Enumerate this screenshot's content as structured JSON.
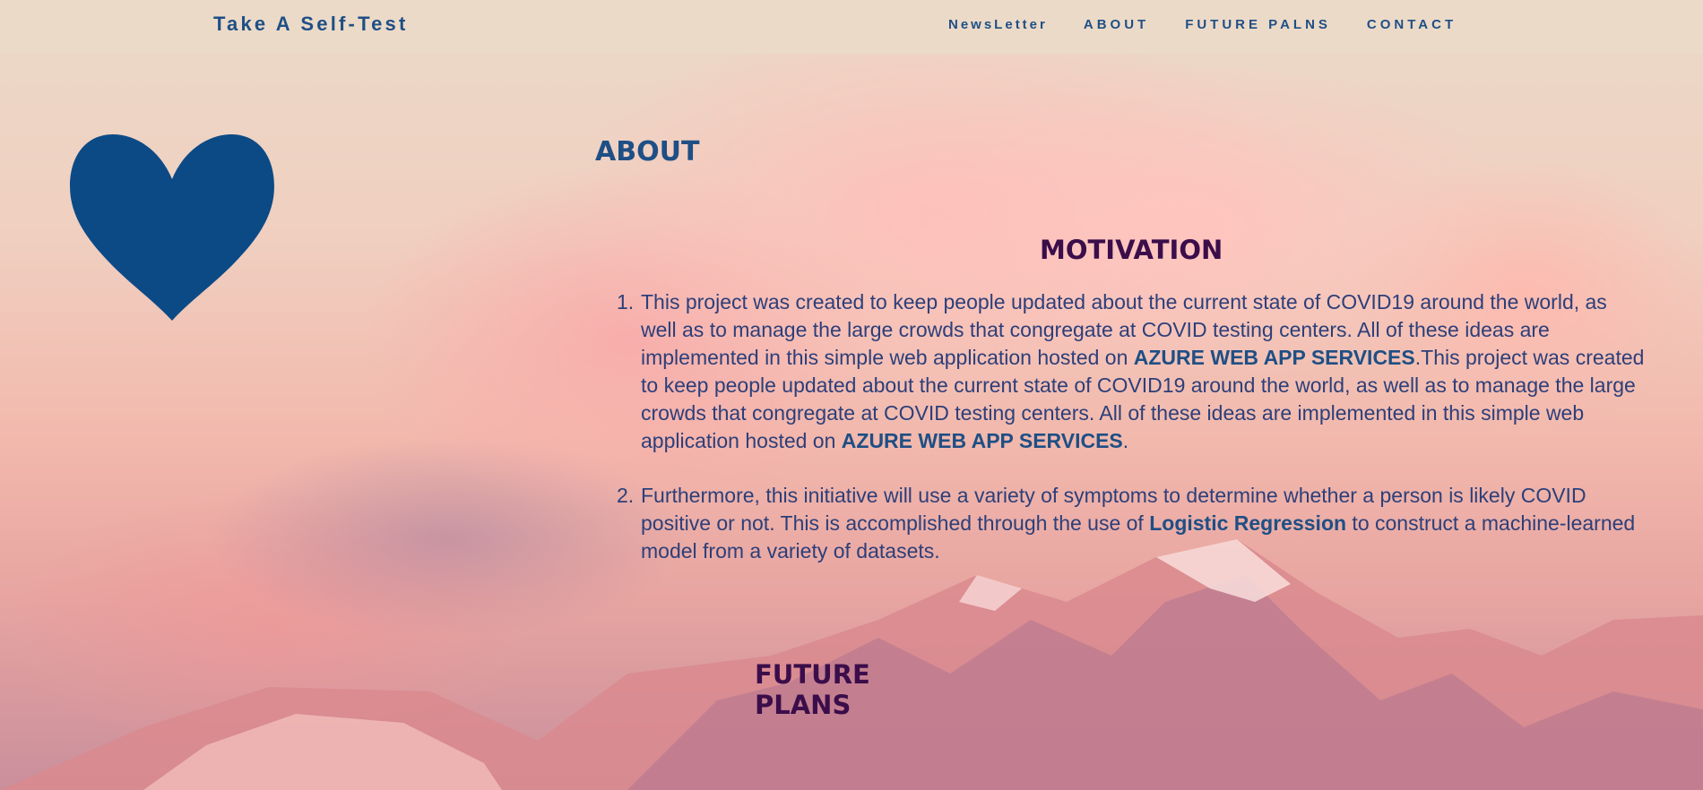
{
  "header": {
    "brand": "Take A Self-Test",
    "nav": [
      "NewsLetter",
      "ABOUT",
      "FUTURE PALNS",
      "CONTACT"
    ]
  },
  "heart_icon": "heart-icon",
  "colors": {
    "brand_blue": "#1e4f85",
    "heading_purple": "#3b0d4a",
    "heart": "#0c4a86"
  },
  "about": {
    "title": "ABOUT",
    "motivation_title": "MOTIVATION",
    "items": [
      {
        "number": "1.",
        "p1": "This project was created to keep people updated about the current state of COVID19 around the world, as well as to manage the large crowds that congregate at COVID testing centers. All of these ideas are implemented in this simple web application hosted on ",
        "b1": "AZURE WEB APP SERVICES",
        "p2": ".This project was created to keep people updated about the current state of COVID19 around the world, as well as to manage the large crowds that congregate at COVID testing centers. All of these ideas are implemented in this simple web application hosted on ",
        "b2": "AZURE WEB APP SERVICES",
        "p3": "."
      },
      {
        "number": "2.",
        "p1": "Furthermore, this initiative will use a variety of symptoms to determine whether a person is likely COVID positive or not. This is accomplished through the use of ",
        "b1": "Logistic Regression",
        "p2": " to construct a machine-learned model from a variety of datasets."
      }
    ]
  },
  "future": {
    "title": "FUTURE PLANS"
  }
}
